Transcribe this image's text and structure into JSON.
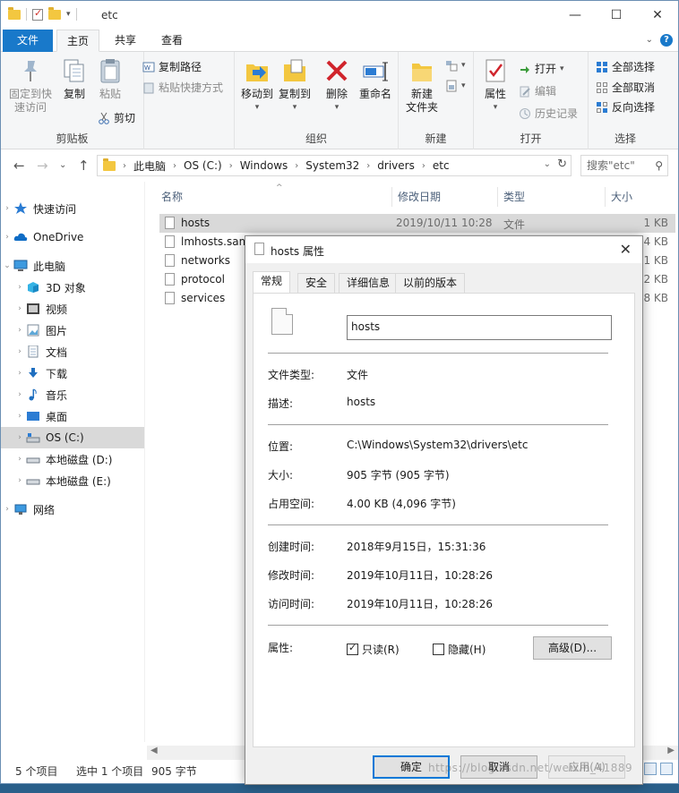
{
  "window": {
    "title": "etc"
  },
  "ribbon": {
    "tabs": {
      "file": "文件",
      "home": "主页",
      "share": "共享",
      "view": "查看"
    },
    "clipboard": {
      "label": "剪贴板",
      "pin": "固定到快\n速访问",
      "pin_line1": "固定到快",
      "pin_line2": "速访问",
      "copy": "复制",
      "paste": "粘贴",
      "copy_path": "复制路径",
      "paste_shortcut": "粘贴快捷方式",
      "cut": "剪切"
    },
    "organize": {
      "label": "组织",
      "move_to": "移动到",
      "copy_to": "复制到",
      "delete": "删除",
      "rename": "重命名"
    },
    "new": {
      "label": "新建",
      "new_folder_line1": "新建",
      "new_folder_line2": "文件夹"
    },
    "open": {
      "label": "打开",
      "properties": "属性",
      "open": "打开",
      "edit": "编辑",
      "history": "历史记录"
    },
    "select": {
      "label": "选择",
      "select_all": "全部选择",
      "select_none": "全部取消",
      "invert": "反向选择"
    }
  },
  "address": {
    "crumbs": [
      "此电脑",
      "OS (C:)",
      "Windows",
      "System32",
      "drivers",
      "etc"
    ],
    "search_placeholder": "搜索\"etc\""
  },
  "nav": {
    "items": [
      {
        "label": "快速访问",
        "icon": "star-icon"
      },
      {
        "label": "OneDrive",
        "icon": "cloud-icon"
      },
      {
        "label": "此电脑",
        "icon": "computer-icon"
      },
      {
        "label": "3D 对象",
        "icon": "cube-icon"
      },
      {
        "label": "视频",
        "icon": "video-icon"
      },
      {
        "label": "图片",
        "icon": "picture-icon"
      },
      {
        "label": "文档",
        "icon": "document-icon"
      },
      {
        "label": "下载",
        "icon": "download-icon"
      },
      {
        "label": "音乐",
        "icon": "music-icon"
      },
      {
        "label": "桌面",
        "icon": "desktop-icon"
      },
      {
        "label": "OS (C:)",
        "icon": "drive-icon"
      },
      {
        "label": "本地磁盘 (D:)",
        "icon": "drive-icon"
      },
      {
        "label": "本地磁盘 (E:)",
        "icon": "drive-icon"
      },
      {
        "label": "网络",
        "icon": "network-icon"
      }
    ]
  },
  "filelist": {
    "columns": {
      "name": "名称",
      "date": "修改日期",
      "type": "类型",
      "size": "大小"
    },
    "rows": [
      {
        "name": "hosts",
        "date": "2019/10/11 10:28",
        "type": "文件",
        "size": "1 KB"
      },
      {
        "name": "lmhosts.sam",
        "date": "",
        "type": "",
        "size": "4 KB"
      },
      {
        "name": "networks",
        "date": "",
        "type": "",
        "size": "1 KB"
      },
      {
        "name": "protocol",
        "date": "",
        "type": "",
        "size": "2 KB"
      },
      {
        "name": "services",
        "date": "",
        "type": "",
        "size": "18 KB"
      }
    ]
  },
  "status": {
    "count": "5 个项目",
    "selection": "选中 1 个项目",
    "size": "905 字节"
  },
  "dialog": {
    "title": "hosts 属性",
    "tabs": [
      "常规",
      "安全",
      "详细信息",
      "以前的版本"
    ],
    "filename": "hosts",
    "labels": {
      "type": "文件类型:",
      "desc": "描述:",
      "location": "位置:",
      "size": "大小:",
      "disk_size": "占用空间:",
      "created": "创建时间:",
      "modified": "修改时间:",
      "accessed": "访问时间:",
      "attributes": "属性:"
    },
    "values": {
      "type": "文件",
      "desc": "hosts",
      "location": "C:\\Windows\\System32\\drivers\\etc",
      "size": "905 字节 (905 字节)",
      "disk_size": "4.00 KB (4,096 字节)",
      "created": "2018年9月15日，15:31:36",
      "modified": "2019年10月11日，10:28:26",
      "accessed": "2019年10月11日，10:28:26"
    },
    "readonly": {
      "label": "只读(R)",
      "checked": true
    },
    "hidden": {
      "label": "隐藏(H)",
      "checked": false
    },
    "advanced": "高级(D)...",
    "ok": "确定",
    "cancel": "取消",
    "apply": "应用(A)"
  },
  "watermark": "https://blog.csdn.net/weixin_41889"
}
